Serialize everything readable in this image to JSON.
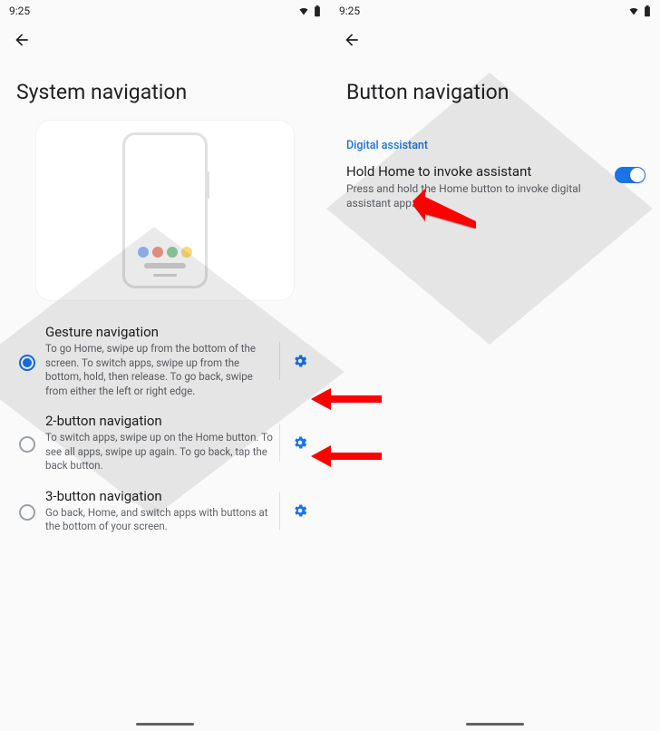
{
  "status": {
    "time": "9:25"
  },
  "left": {
    "title": "System navigation",
    "options": [
      {
        "title": "Gesture navigation",
        "desc": "To go Home, swipe up from the bottom of the screen. To switch apps, swipe up from the bottom, hold, then release. To go back, swipe from either the left or right edge.",
        "selected": true
      },
      {
        "title": "2-button navigation",
        "desc": "To switch apps, swipe up on the Home button. To see all apps, swipe up again. To go back, tap the back button.",
        "selected": false
      },
      {
        "title": "3-button navigation",
        "desc": "Go back, Home, and switch apps with buttons at the bottom of your screen.",
        "selected": false
      }
    ]
  },
  "right": {
    "title": "Button navigation",
    "section": "Digital assistant",
    "pref_title": "Hold Home to invoke assistant",
    "pref_desc": "Press and hold the Home button to invoke digital assistant app.",
    "toggle": true
  }
}
